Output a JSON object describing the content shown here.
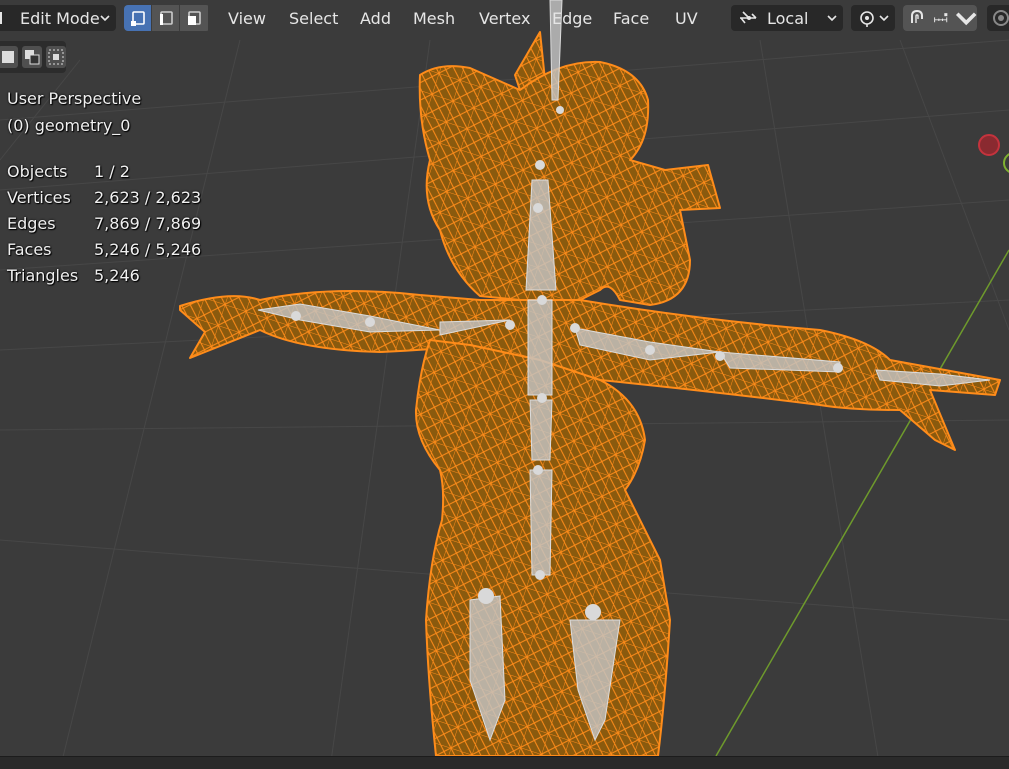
{
  "header": {
    "mode": "Edit Mode",
    "menus": [
      "View",
      "Select",
      "Add",
      "Mesh",
      "Vertex",
      "Edge",
      "Face",
      "UV"
    ],
    "pivot": "Local"
  },
  "overlay": {
    "view_name": "User Perspective",
    "object_name": "(0) geometry_0",
    "stats": [
      {
        "label": "Objects",
        "value": "1 / 2"
      },
      {
        "label": "Vertices",
        "value": "2,623 / 2,623"
      },
      {
        "label": "Edges",
        "value": "7,869 / 7,869"
      },
      {
        "label": "Faces",
        "value": "5,246 / 5,246"
      },
      {
        "label": "Triangles",
        "value": "5,246"
      }
    ]
  },
  "icons": {
    "mode": "edit-mode-icon",
    "select_vertex": "vertex-select-icon",
    "select_edge": "edge-select-icon",
    "select_face": "face-select-icon",
    "pivot": "transform-orientation-icon",
    "snap_pivot": "pivot-point-icon",
    "snap": "magnet-icon",
    "snap_to": "snap-increment-icon",
    "proportional": "proportional-edit-icon"
  },
  "colors": {
    "viewport_bg": "#3b3b3b",
    "header_dropdown": "#282828",
    "active_button": "#4772b3",
    "mesh_selected": "#ff8c1a",
    "mesh_fill": "#8a5a0e",
    "bone": "#b8b8b8",
    "axis_y": "#6e9a2c",
    "gizmo_x": "#c4333d"
  }
}
